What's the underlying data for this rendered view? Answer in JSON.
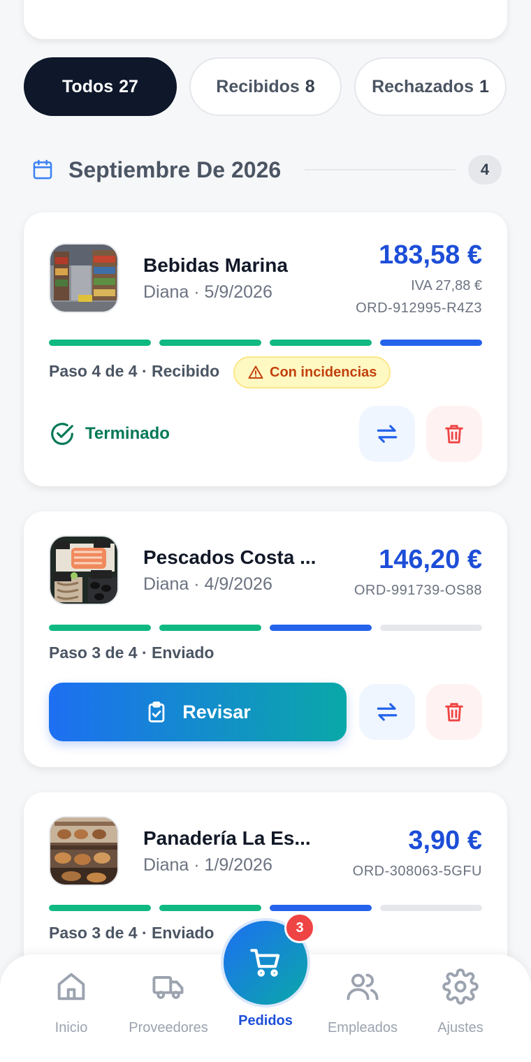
{
  "filters": [
    {
      "label": "Todos",
      "count": "27"
    },
    {
      "label": "Recibidos",
      "count": "8"
    },
    {
      "label": "Rechazados",
      "count": "1"
    }
  ],
  "month": {
    "title": "Septiembre De 2026",
    "count": "4"
  },
  "orders": [
    {
      "supplier": "Bebidas Marina",
      "meta": "Diana · 5/9/2026",
      "price": "183,58 €",
      "iva": "IVA 27,88 €",
      "order_id": "ORD-912995-R4Z3",
      "progress": [
        1,
        1,
        1,
        2
      ],
      "step": "Paso 4 de 4 · Recibido",
      "issues_label": "Con incidencias",
      "status_label": "Terminado"
    },
    {
      "supplier": "Pescados Costa ...",
      "meta": "Diana · 4/9/2026",
      "price": "146,20 €",
      "order_id": "ORD-991739-OS88",
      "progress": [
        1,
        1,
        2,
        0
      ],
      "step": "Paso 3 de 4 · Enviado",
      "action_label": "Revisar"
    },
    {
      "supplier": "Panadería La Es...",
      "meta": "Diana · 1/9/2026",
      "price": "3,90 €",
      "order_id": "ORD-308063-5GFU",
      "progress": [
        1,
        1,
        2,
        0
      ],
      "step": "Paso 3 de 4 · Enviado"
    }
  ],
  "nav": {
    "items": [
      {
        "label": "Inicio",
        "icon": "home-icon"
      },
      {
        "label": "Proveedores",
        "icon": "truck-icon"
      },
      {
        "label": "Pedidos",
        "icon": "cart-icon"
      },
      {
        "label": "Empleados",
        "icon": "users-icon"
      },
      {
        "label": "Ajustes",
        "icon": "gear-icon"
      }
    ],
    "cart_badge": "3"
  },
  "colors": {
    "accent": "#1d4ed8",
    "success": "#10b981",
    "progress_current": "#2563eb",
    "danger": "#ef4444",
    "dark": "#0f172a"
  }
}
